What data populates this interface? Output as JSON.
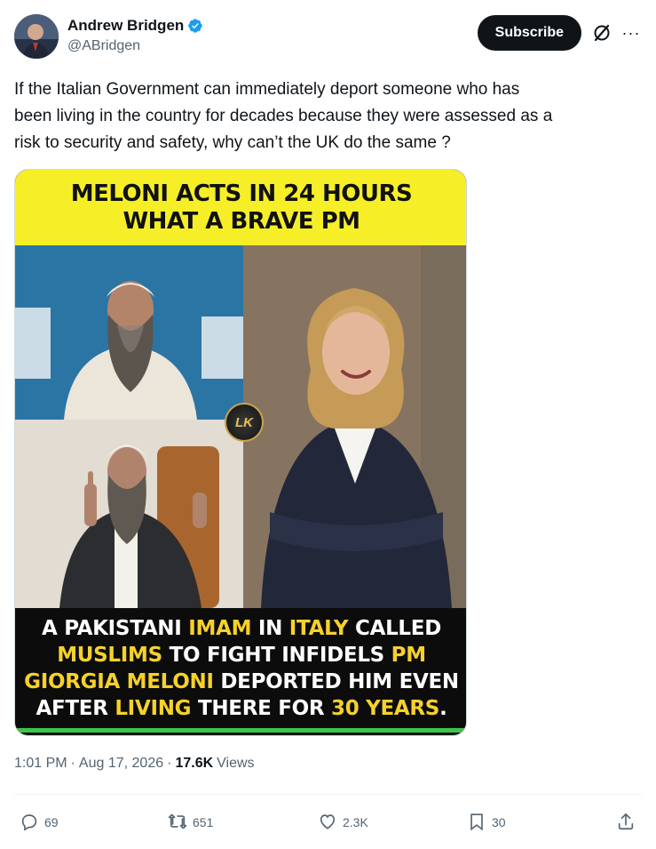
{
  "author": {
    "name": "Andrew Bridgen",
    "handle": "@ABridgen"
  },
  "header": {
    "subscribe_label": "Subscribe",
    "more_label": "···"
  },
  "tweet": {
    "text": "If the Italian Government can immediately deport someone who has\nbeen living in the country for decades because they were assessed as a\nrisk to security and safety, why can’t the UK do the same ?"
  },
  "media": {
    "top_banner": [
      "MELONI ACTS IN 24 HOURS",
      "WHAT A BRAVE PM"
    ],
    "badge": "LK",
    "bottom_banner": {
      "l1a": "A PAKISTANI ",
      "l1b": "IMAM",
      "l1c": " IN ",
      "l1d": "ITALY",
      "l1e": " CALLED",
      "l2a": "MUSLIMS",
      "l2b": " TO FIGHT INFIDELS ",
      "l2c": "PM",
      "l3a": "GIORGIA MELONI",
      "l3b": " DEPORTED HIM EVEN",
      "l4a": "AFTER ",
      "l4b": "LIVING",
      "l4c": " THERE FOR ",
      "l4d": "30 YEARS",
      "l4e": "."
    }
  },
  "meta": {
    "time": "1:01 PM",
    "sep1": "·",
    "date": "Aug 17, 2026",
    "sep2": "·",
    "views_count": "17.6K",
    "views_label": "Views"
  },
  "actions": {
    "replies": "69",
    "reposts": "651",
    "likes": "2.3K",
    "bookmarks": "30"
  },
  "colors": {
    "verified": "#1d9bf0",
    "banner_yellow": "#f6ef27",
    "highlight": "#f6d12a",
    "green_bar": "#3fc449"
  }
}
